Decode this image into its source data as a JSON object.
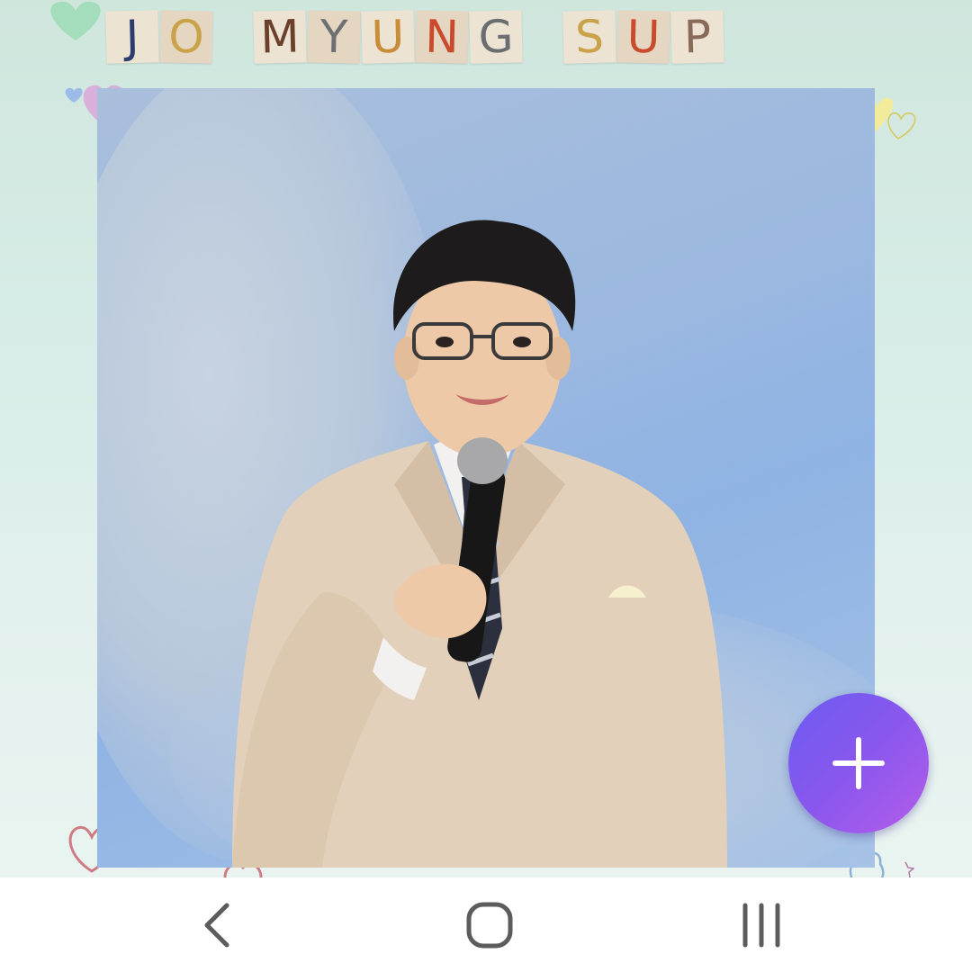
{
  "title": {
    "words": [
      {
        "letters": [
          "J",
          "O"
        ],
        "colors": [
          "#2d3c6e",
          "#c9a24a"
        ]
      },
      {
        "letters": [
          "M",
          "Y",
          "U",
          "N",
          "G"
        ],
        "colors": [
          "#6b3f2a",
          "#6d6f73",
          "#c98d3a",
          "#c94a2c",
          "#6b6e70"
        ]
      },
      {
        "letters": [
          "S",
          "U",
          "P"
        ],
        "colors": [
          "#c9a24a",
          "#c94a2c",
          "#8a6b5a"
        ]
      }
    ]
  },
  "fab": {
    "icon": "plus-icon",
    "gradient": [
      "#6a5cf0",
      "#b45de8"
    ]
  },
  "navbar": {
    "buttons": [
      {
        "name": "back",
        "icon": "chevron-left-icon"
      },
      {
        "name": "home",
        "icon": "rounded-square-icon"
      },
      {
        "name": "recents",
        "icon": "three-bars-icon"
      }
    ]
  }
}
